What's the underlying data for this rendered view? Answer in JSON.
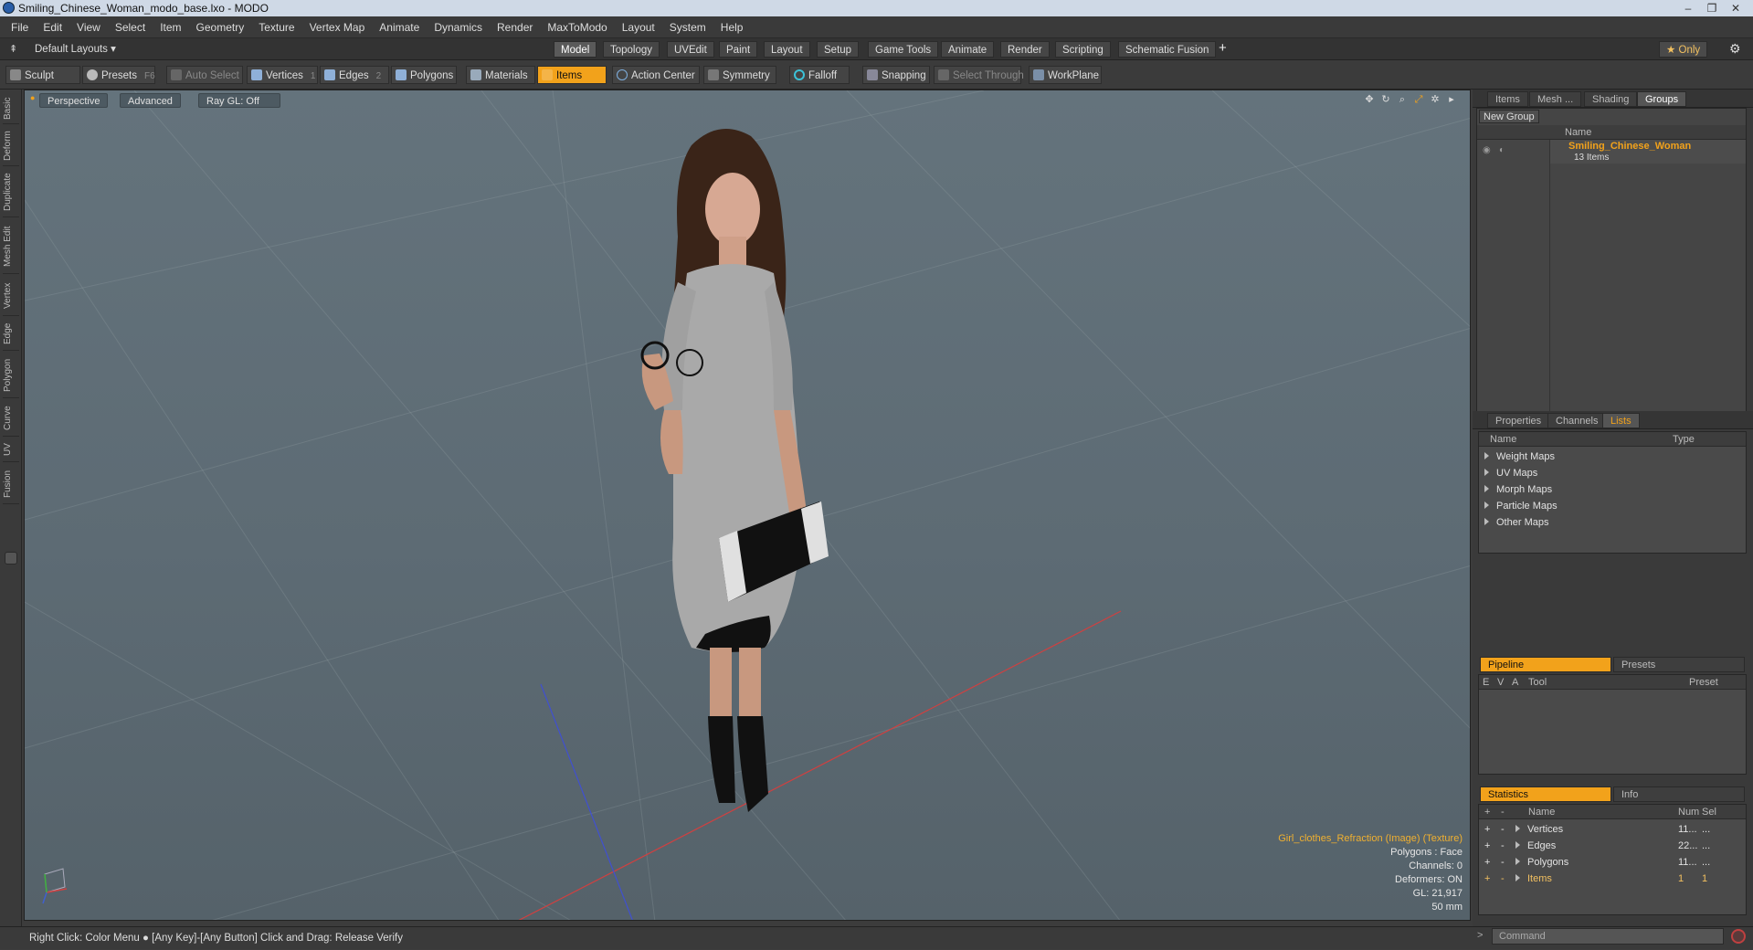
{
  "window": {
    "title": "Smiling_Chinese_Woman_modo_base.lxo - MODO",
    "controls": [
      "–",
      "❐",
      "✕"
    ]
  },
  "menu": [
    "File",
    "Edit",
    "View",
    "Select",
    "Item",
    "Geometry",
    "Texture",
    "Vertex Map",
    "Animate",
    "Dynamics",
    "Render",
    "MaxToModo",
    "Layout",
    "System",
    "Help"
  ],
  "layoutbar": {
    "default_layouts": "Default Layouts ▾",
    "tabs": [
      "Model",
      "Topology",
      "UVEdit",
      "Paint",
      "Layout",
      "Setup",
      "Game Tools",
      "Animate",
      "Render",
      "Scripting",
      "Schematic Fusion"
    ],
    "active_tab": "Model",
    "plus": "+",
    "only_label": "★ Only",
    "gear": "⚙"
  },
  "toolbar": {
    "sculpt": "Sculpt",
    "presets": "Presets",
    "presets_key": "F6",
    "auto_select": "Auto Select",
    "vertices": "Vertices",
    "vertices_key": "1",
    "edges": "Edges",
    "edges_key": "2",
    "polygons": "Polygons",
    "materials": "Materials",
    "items": "Items",
    "action_center": "Action Center",
    "symmetry": "Symmetry",
    "falloff": "Falloff",
    "snapping": "Snapping",
    "select_through": "Select Through",
    "workplane": "WorkPlane"
  },
  "left_tabs": [
    "Basic",
    "Deform",
    "Duplicate",
    "Mesh Edit",
    "Vertex",
    "Edge",
    "Polygon",
    "Curve",
    "UV",
    "Fusion"
  ],
  "viewport": {
    "perspective": "Perspective",
    "advanced": "Advanced",
    "raygl": "Ray GL: Off",
    "info": {
      "texture": "Girl_clothes_Refraction (Image) (Texture)",
      "polygons": "Polygons : Face",
      "channels": "Channels: 0",
      "deformers": "Deformers: ON",
      "gl": "GL: 21,917",
      "focal": "50 mm"
    }
  },
  "groups_panel": {
    "tabs": [
      "Items",
      "Mesh ...",
      "Shading",
      "Groups"
    ],
    "active": "Groups",
    "new_group": "New Group",
    "col_name": "Name",
    "group_name": "Smiling_Chinese_Woman",
    "group_count": "13 Items"
  },
  "lists_panel": {
    "tabs": [
      "Properties",
      "Channels",
      "Lists"
    ],
    "active": "Lists",
    "col_name": "Name",
    "col_type": "Type",
    "items": [
      "Weight Maps",
      "UV Maps",
      "Morph Maps",
      "Particle Maps",
      "Other Maps"
    ]
  },
  "pipeline_panel": {
    "tabs": [
      "Pipeline",
      "Presets"
    ],
    "cols": [
      "E",
      "V",
      "A",
      "Tool",
      "Preset"
    ]
  },
  "stats_panel": {
    "tabs": [
      "Statistics",
      "Info"
    ],
    "cols": [
      "Name",
      "Num",
      "Sel"
    ],
    "rows": [
      {
        "name": "Vertices",
        "num": "11...",
        "sel": "..."
      },
      {
        "name": "Edges",
        "num": "22...",
        "sel": "..."
      },
      {
        "name": "Polygons",
        "num": "11...",
        "sel": "..."
      },
      {
        "name": "Items",
        "num": "1",
        "sel": "1"
      }
    ]
  },
  "statusbar": {
    "text": "Right Click: Color Menu ● [Any Key]-[Any Button] Click and Drag: Release Verify",
    "command_placeholder": "Command"
  },
  "colors": {
    "accent": "#f2a21b",
    "viewport": "#5e6c75"
  }
}
